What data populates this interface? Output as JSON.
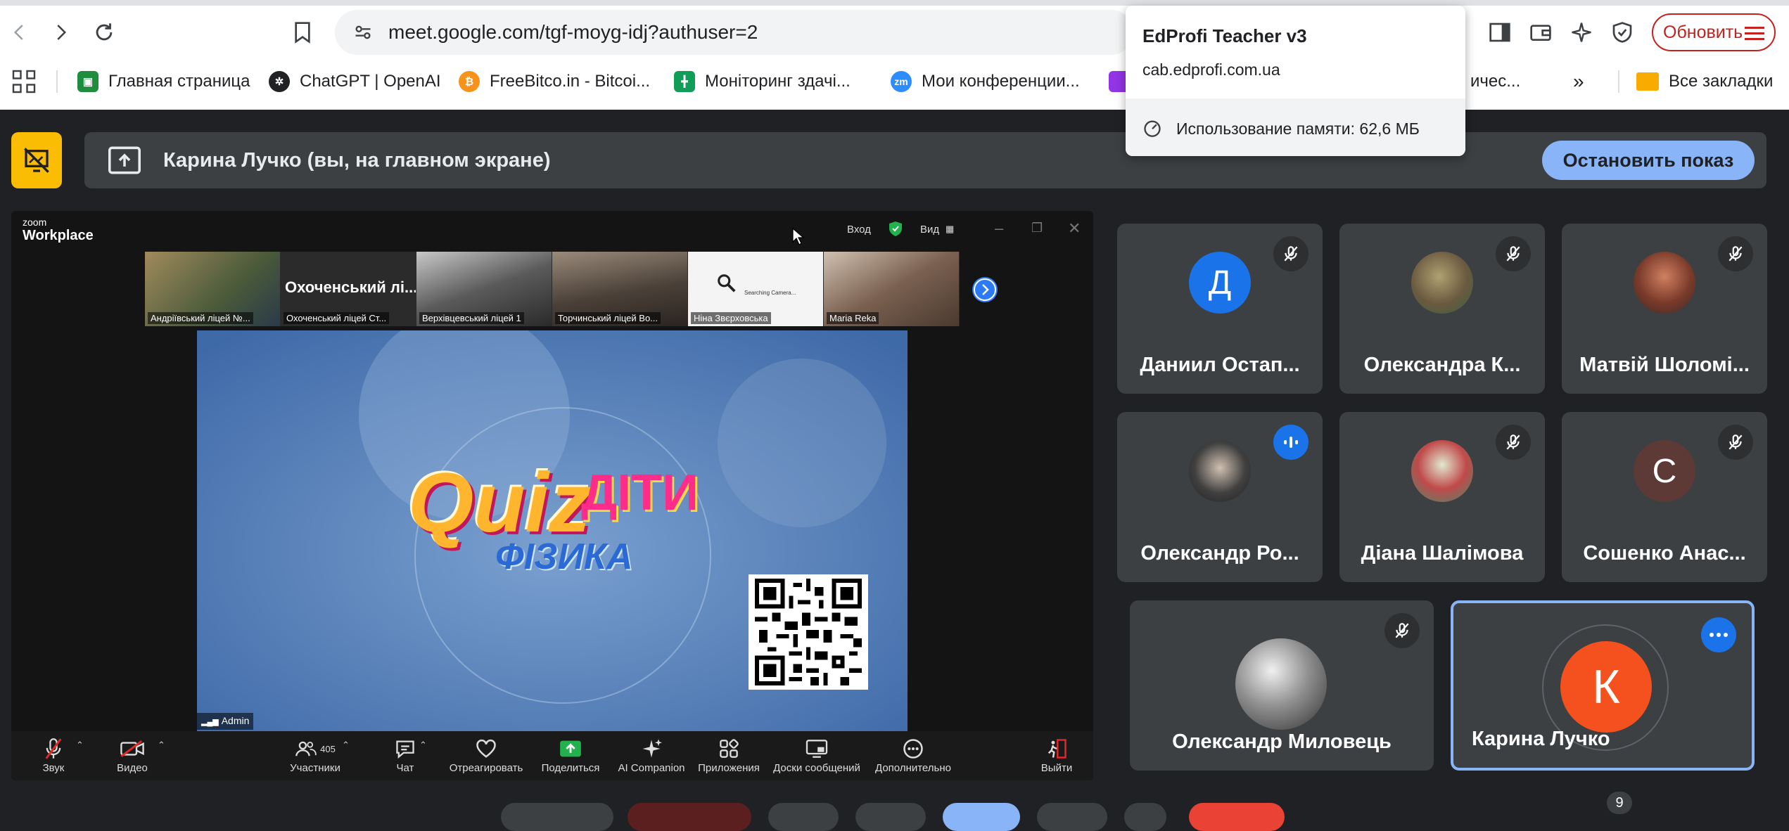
{
  "browser": {
    "url": "meet.google.com/tgf-moyg-idj?authuser=2",
    "update_label": "Обновить",
    "bookmarks": [
      {
        "label": "Главная страница",
        "icon": "classroom-icon",
        "color": "#1e8e3e"
      },
      {
        "label": "ChatGPT | OpenAI",
        "icon": "openai-icon",
        "color": "#202124"
      },
      {
        "label": "FreeBitco.in - Bitcoi...",
        "icon": "bitcoin-icon",
        "color": "#f7931a"
      },
      {
        "label": "Моніторинг здачі...",
        "icon": "sheets-icon",
        "color": "#0f9d58"
      },
      {
        "label": "Мои конференции...",
        "icon": "zoom-icon",
        "color": "#2d8cff"
      },
      {
        "label": "ичес...",
        "icon": "extension-icon",
        "color": "#9334e6"
      }
    ],
    "all_bookmarks": "Все закладки"
  },
  "popup": {
    "title": "EdProfi Teacher v3",
    "domain": "cab.edprofi.com.ua",
    "memory": "Использование памяти: 62,6 МБ"
  },
  "meet": {
    "presenting_text": "Карина Лучко (вы, на главном экране)",
    "stop_label": "Остановить показ",
    "participants": [
      {
        "name": "Даниил Остап...",
        "initial": "Д",
        "avatar_color": "#1a73e8",
        "mic": "muted"
      },
      {
        "name": "Олександра К...",
        "initial": "",
        "avatar_color": "#7a8a5a",
        "mic": "muted"
      },
      {
        "name": "Матвій Шоломі...",
        "initial": "",
        "avatar_color": "#8a4a3a",
        "mic": "muted"
      },
      {
        "name": "Олександр Ро...",
        "initial": "",
        "avatar_color": "#555555",
        "mic": "speaking"
      },
      {
        "name": "Діана Шалімова",
        "initial": "",
        "avatar_color": "#6a9a7a",
        "mic": "muted"
      },
      {
        "name": "Сошенко Анас...",
        "initial": "С",
        "avatar_color": "#5d3a35",
        "mic": "muted"
      },
      {
        "name": "Олександр Миловець",
        "initial": "",
        "avatar_color": "#777777",
        "mic": "muted"
      },
      {
        "name": "Карина Лучко",
        "initial": "К",
        "avatar_color": "#f4511e",
        "mic": "more"
      }
    ],
    "hidden_count": "9"
  },
  "zoom": {
    "brand_small": "zoom",
    "brand": "Workplace",
    "login": "Вход",
    "view": "Вид",
    "thumbnails": [
      {
        "caption": "Андріївський ліцей №...",
        "bg": "#8a7a5a"
      },
      {
        "caption": "Охоченський ліцей Ст...",
        "title": "Охоченський лі...",
        "bg": "#2b2b2b"
      },
      {
        "caption": "Верхівцевський ліцей 1",
        "bg": "#6a6a6a"
      },
      {
        "caption": "Торчинський ліцей Во...",
        "bg": "#5a5048"
      },
      {
        "caption": "Ніна Звєрховська",
        "bg": "#f4f4f4",
        "searching": "Searching Camera..."
      },
      {
        "caption": "Maria Reka",
        "bg": "#8a7060"
      }
    ],
    "main_video": {
      "line1": "Quiz",
      "line2": "ДІТИ",
      "line3": "ФІЗИКА"
    },
    "admin_tag": "Admin",
    "toolbar": {
      "audio": "Звук",
      "video": "Видео",
      "participants": "Участники",
      "participants_count": "405",
      "chat": "Чат",
      "react": "Отреагировать",
      "share": "Поделиться",
      "ai": "AI Companion",
      "apps": "Приложения",
      "boards": "Доски сообщений",
      "more": "Дополнительно",
      "leave": "Выйти"
    }
  }
}
